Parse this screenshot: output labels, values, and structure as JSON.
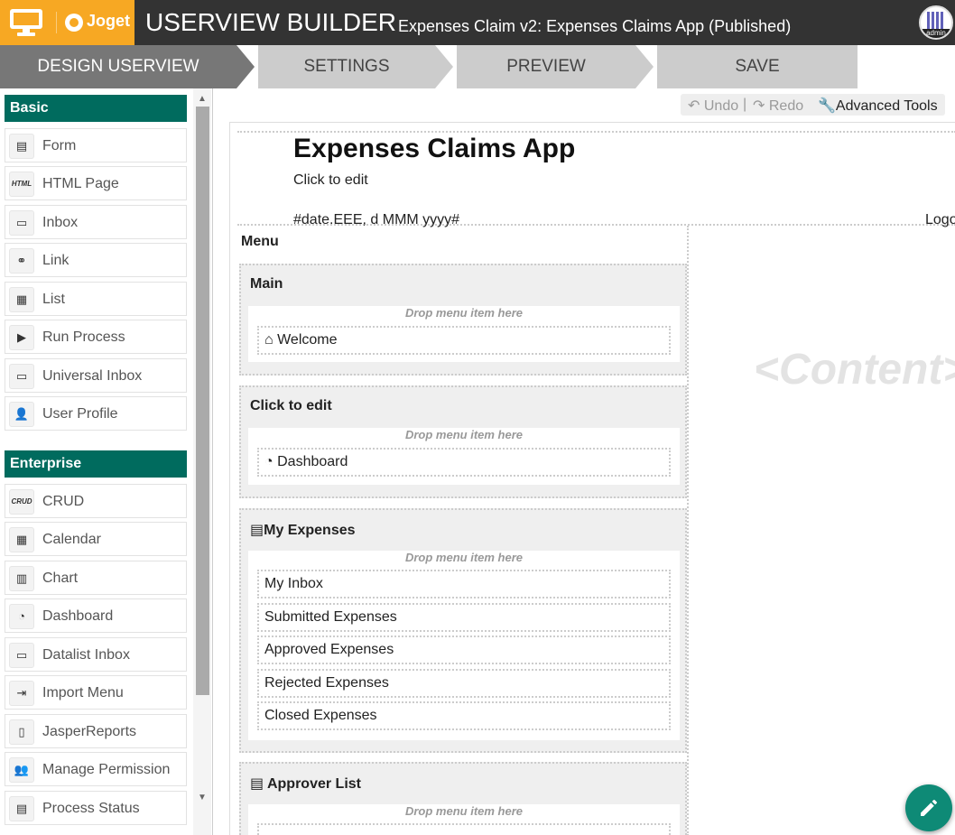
{
  "header": {
    "brand": "Joget",
    "builder_title": "USERVIEW BUILDER",
    "app_title": "Expenses Claim v2: Expenses Claims App (Published)",
    "avatar_label": "admin"
  },
  "steps": [
    {
      "label": "DESIGN USERVIEW",
      "active": true
    },
    {
      "label": "SETTINGS",
      "active": false
    },
    {
      "label": "PREVIEW",
      "active": false
    },
    {
      "label": "SAVE",
      "active": false
    }
  ],
  "sidebar": {
    "basic_title": "Basic",
    "basic_items": [
      {
        "label": "Form",
        "icon": "form-icon"
      },
      {
        "label": "HTML Page",
        "icon": "html-icon"
      },
      {
        "label": "Inbox",
        "icon": "inbox-icon"
      },
      {
        "label": "Link",
        "icon": "link-icon"
      },
      {
        "label": "List",
        "icon": "list-icon"
      },
      {
        "label": "Run Process",
        "icon": "play-icon"
      },
      {
        "label": "Universal Inbox",
        "icon": "inbox-icon"
      },
      {
        "label": "User Profile",
        "icon": "user-edit-icon"
      }
    ],
    "enterprise_title": "Enterprise",
    "enterprise_items": [
      {
        "label": "CRUD",
        "icon": "crud-icon"
      },
      {
        "label": "Calendar",
        "icon": "calendar-icon"
      },
      {
        "label": "Chart",
        "icon": "chart-icon"
      },
      {
        "label": "Dashboard",
        "icon": "dashboard-icon"
      },
      {
        "label": "Datalist Inbox",
        "icon": "inbox-icon"
      },
      {
        "label": "Import Menu",
        "icon": "import-icon"
      },
      {
        "label": "JasperReports",
        "icon": "report-icon"
      },
      {
        "label": "Manage Permission",
        "icon": "users-lock-icon"
      },
      {
        "label": "Process Status",
        "icon": "process-icon"
      }
    ]
  },
  "toolbar": {
    "undo": "Undo",
    "separator": "|",
    "redo": "Redo",
    "advanced": "Advanced Tools"
  },
  "canvas": {
    "app_name": "Expenses Claims App",
    "header_sub": "Click to edit",
    "date_format": "#date.EEE, d MMM yyyy#",
    "logout": "Logo",
    "menu_title": "Menu",
    "content_placeholder": "<Content>",
    "drop_hint": "Drop menu item here",
    "categories": [
      {
        "label": "Main",
        "items": [
          "Welcome"
        ]
      },
      {
        "label": "Click to edit",
        "items": [
          "Dashboard"
        ]
      },
      {
        "label": "My Expenses",
        "items": [
          "My Inbox",
          "Submitted Expenses",
          "Approved Expenses",
          "Rejected Expenses",
          "Closed Expenses"
        ]
      },
      {
        "label": "Approver List",
        "items": []
      }
    ]
  },
  "colors": {
    "accent_orange": "#f7a823",
    "section_green": "#006b5e",
    "fab_green": "#0e8a76",
    "topbar": "#333333"
  }
}
